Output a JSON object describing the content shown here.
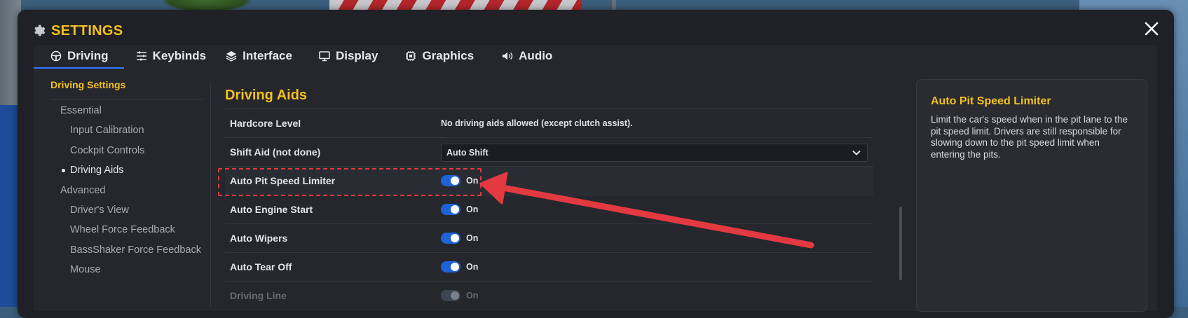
{
  "window": {
    "title": "SETTINGS",
    "close_label": "✕"
  },
  "tabs": [
    {
      "label": "Driving",
      "icon": "steering-wheel-icon",
      "active": true
    },
    {
      "label": "Keybinds",
      "icon": "sliders-icon",
      "active": false
    },
    {
      "label": "Interface",
      "icon": "layers-icon",
      "active": false
    },
    {
      "label": "Display",
      "icon": "monitor-icon",
      "active": false
    },
    {
      "label": "Graphics",
      "icon": "chip-icon",
      "active": false
    },
    {
      "label": "Audio",
      "icon": "speaker-icon",
      "active": false
    }
  ],
  "sidebar": {
    "title": "Driving Settings",
    "items": [
      {
        "label": "Essential",
        "type": "group"
      },
      {
        "label": "Input Calibration",
        "type": "item"
      },
      {
        "label": "Cockpit Controls",
        "type": "item"
      },
      {
        "label": "Driving Aids",
        "type": "item",
        "active": true
      },
      {
        "label": "Advanced",
        "type": "group"
      },
      {
        "label": "Driver's View",
        "type": "item"
      },
      {
        "label": "Wheel Force Feedback",
        "type": "item"
      },
      {
        "label": "BassShaker Force Feedback",
        "type": "item"
      },
      {
        "label": "Mouse",
        "type": "item"
      }
    ]
  },
  "main": {
    "title": "Driving Aids",
    "rows": [
      {
        "label": "Hardcore Level",
        "kind": "text",
        "value": "No driving aids allowed (except clutch assist)."
      },
      {
        "label": "Shift Aid (not done)",
        "kind": "select",
        "value": "Auto Shift"
      },
      {
        "label": "Auto Pit Speed Limiter",
        "kind": "toggle",
        "value": "On",
        "on": true,
        "highlighted": true
      },
      {
        "label": "Auto Engine Start",
        "kind": "toggle",
        "value": "On",
        "on": true
      },
      {
        "label": "Auto Wipers",
        "kind": "toggle",
        "value": "On",
        "on": true
      },
      {
        "label": "Auto Tear Off",
        "kind": "toggle",
        "value": "On",
        "on": true
      },
      {
        "label": "Driving Line",
        "kind": "toggle",
        "value": "On",
        "on": true,
        "disabled": true
      }
    ]
  },
  "help": {
    "title": "Auto Pit Speed Limiter",
    "body": "Limit the car's speed when in the pit lane to the pit speed limit. Drivers are still responsible for slowing down to the pit speed limit when entering the pits."
  },
  "colors": {
    "accent": "#f2c01e",
    "toggle_on": "#1f63d9",
    "tab_underline": "#2f77ff",
    "annotation": "#e03a3e"
  }
}
